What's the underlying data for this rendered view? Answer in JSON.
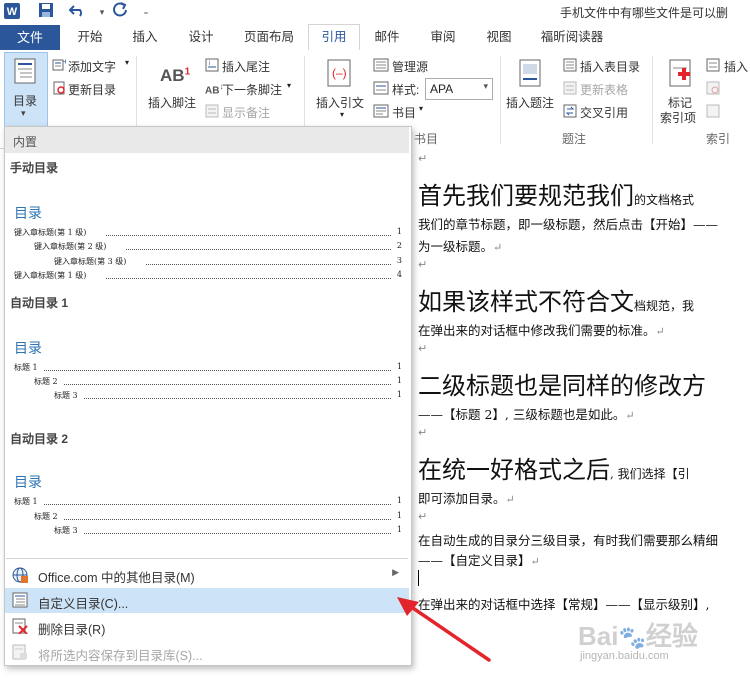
{
  "title_bar": {
    "title": "手机文件中有哪些文件是可以删"
  },
  "tabs": [
    {
      "label": "文件"
    },
    {
      "label": "开始"
    },
    {
      "label": "插入"
    },
    {
      "label": "设计"
    },
    {
      "label": "页面布局"
    },
    {
      "label": "引用"
    },
    {
      "label": "邮件"
    },
    {
      "label": "审阅"
    },
    {
      "label": "视图"
    },
    {
      "label": "福昕阅读器"
    }
  ],
  "ribbon": {
    "toc_button": "目录",
    "add_text": "添加文字",
    "update_toc": "更新目录",
    "insert_footnote": "插入脚注",
    "insert_endnote": "插入尾注",
    "next_footnote": "下一条脚注",
    "show_notes": "显示备注",
    "insert_citation": "插入引文",
    "manage_sources": "管理源",
    "style_label": "样式:",
    "style_value": "APA",
    "bibliography": "书目",
    "insert_caption": "插入题注",
    "insert_table_of_figures": "插入表目录",
    "update_table": "更新表格",
    "cross_reference": "交叉引用",
    "mark_entry": "标记",
    "mark_entry_2": "索引项",
    "insert_index": "插入",
    "group_citations": "书目",
    "group_captions": "题注",
    "group_index": "索引",
    "footnote_icon_text": "AB",
    "footnote_icon_sup": "1",
    "next_footnote_icon": "AB"
  },
  "dropdown": {
    "header": "内置",
    "manual_title": "手动目录",
    "auto1_title": "自动目录 1",
    "auto2_title": "自动目录 2",
    "toc_heading": "目录",
    "manual_lines": [
      {
        "text": "键入章标题(第 1 级)",
        "page": "1"
      },
      {
        "text": "键入章标题(第 2 级)",
        "page": "2"
      },
      {
        "text": "键入章标题(第 3 级)",
        "page": "3"
      },
      {
        "text": "键入章标题(第 1 级)",
        "page": "4"
      }
    ],
    "auto_lines": [
      {
        "text": "标题 1",
        "page": "1"
      },
      {
        "text": "标题 2",
        "page": "1"
      },
      {
        "text": "标题 3",
        "page": "1"
      }
    ],
    "menu": [
      {
        "label": "Office.com 中的其他目录(M)",
        "icon": "office-globe-icon",
        "enabled": true
      },
      {
        "label": "自定义目录(C)...",
        "icon": "custom-toc-icon",
        "enabled": true,
        "highlighted": true
      },
      {
        "label": "删除目录(R)",
        "icon": "delete-toc-icon",
        "enabled": true
      },
      {
        "label": "将所选内容保存到目录库(S)...",
        "icon": "save-selection-icon",
        "enabled": false
      }
    ]
  },
  "document": {
    "lines": [
      {
        "big": "首先我们要规范我们",
        "small": "的文档格式"
      },
      {
        "small": "我们的章节标题，即一级标题，然后点击【开始】——"
      },
      {
        "small": "为一级标题。"
      },
      {
        "big": "如果该样式不符合文",
        "small": "档规范，我"
      },
      {
        "small": "在弹出来的对话框中修改我们需要的标准。"
      },
      {
        "big": "二级标题也是同样的修改方"
      },
      {
        "small": "——【标题 2】, 三级标题也是如此。"
      },
      {
        "big": "在统一好格式之后",
        "small": ", 我们选择【引"
      },
      {
        "small": "即可添加目录。"
      },
      {
        "small": "在自动生成的目录分三级目录，有时我们需要那么精细"
      },
      {
        "small": "——【自定义目录】"
      },
      {
        "small": "在弹出来的对话框中选择【常规】——【显示级别】,"
      }
    ]
  },
  "watermark": {
    "brand": "Bai",
    "brand2": "经验",
    "url": "jingyan.baidu.com"
  },
  "colors": {
    "accent": "#2b579a",
    "highlight": "#cde3f7",
    "arrow": "#e3242b",
    "toc_blue": "#2e74b5"
  }
}
